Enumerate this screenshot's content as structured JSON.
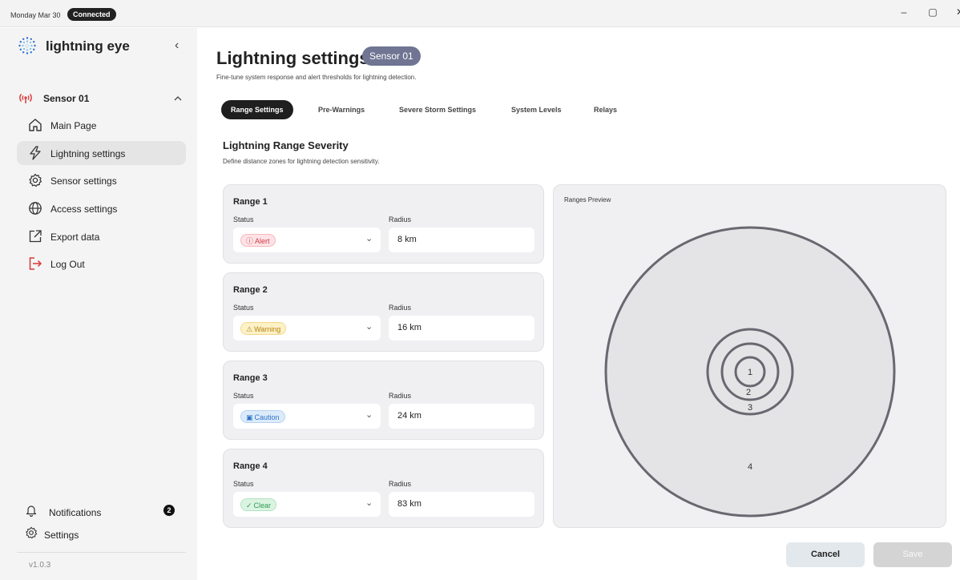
{
  "titlebar": {
    "date": "Monday Mar 30",
    "connection_status": "Connected",
    "minimize_glyph": "–",
    "maximize_glyph": "▢",
    "close_glyph": "✕"
  },
  "sidebar": {
    "brand": "lightning eye",
    "collapse_glyph": "‹",
    "sensor": {
      "label": "Sensor 01",
      "icon": "antenna-icon",
      "chevron": "^"
    },
    "items": [
      {
        "label": "Main Page",
        "icon": "home-icon"
      },
      {
        "label": "Lightning settings",
        "icon": "lightning-icon",
        "active": true
      },
      {
        "label": "Sensor settings",
        "icon": "gear-icon"
      },
      {
        "label": "Access settings",
        "icon": "globe-icon"
      },
      {
        "label": "Export data",
        "icon": "external-link-icon"
      },
      {
        "label": "Log Out",
        "icon": "logout-icon"
      }
    ],
    "notifications": {
      "label": "Notifications",
      "count": "2"
    },
    "settings": {
      "label": "Settings"
    },
    "version": "v1.0.3"
  },
  "main": {
    "title": "Lightning settings",
    "sensor_badge": "Sensor 01",
    "subtitle": "Fine-tune system response and alert thresholds for lightning detection.",
    "tabs": [
      {
        "label": "Range Settings",
        "active": true
      },
      {
        "label": "Pre-Warnings"
      },
      {
        "label": "Severe Storm Settings"
      },
      {
        "label": "System Levels"
      },
      {
        "label": "Relays"
      }
    ],
    "section": {
      "title": "Lightning Range Severity",
      "subtitle": "Define distance zones for lightning detection sensitivity."
    },
    "status_label": "Status",
    "radius_label": "Radius",
    "ranges": [
      {
        "title": "Range 1",
        "status": "Alert",
        "status_icon": "ⓘ",
        "radius": "8 km"
      },
      {
        "title": "Range 2",
        "status": "Warning",
        "status_icon": "⚠",
        "radius": "16 km"
      },
      {
        "title": "Range 3",
        "status": "Caution",
        "status_icon": "▣",
        "radius": "24 km"
      },
      {
        "title": "Range 4",
        "status": "Clear",
        "status_icon": "✓",
        "radius": "83 km"
      }
    ],
    "dropdown_glyph": "⌄",
    "preview": {
      "title": "Ranges Preview",
      "ring_labels": [
        "1",
        "2",
        "3",
        "4"
      ]
    },
    "buttons": {
      "cancel": "Cancel",
      "save": "Save"
    }
  },
  "colors": {
    "accent": "#1f1f1f",
    "sensor_badge": "#6f7592",
    "alert": "#d13a4a",
    "warning": "#b48512",
    "caution": "#2d73c6",
    "clear": "#2d9a52",
    "logout": "#d93838"
  }
}
